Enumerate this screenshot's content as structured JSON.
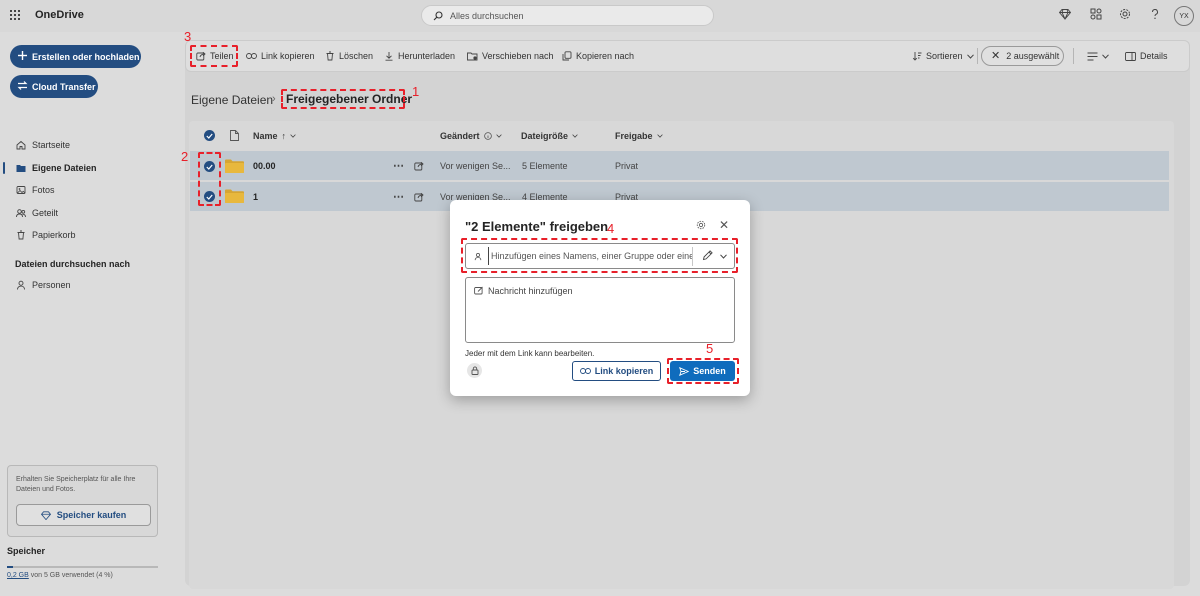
{
  "app": {
    "title": "OneDrive",
    "avatar_initials": "YX"
  },
  "search": {
    "placeholder": "Alles durchsuchen"
  },
  "sidebar": {
    "create_label": "Erstellen oder hochladen",
    "transfer_label": "Cloud Transfer",
    "items": [
      {
        "label": "Startseite",
        "icon": "home-icon"
      },
      {
        "label": "Eigene Dateien",
        "icon": "folder-icon",
        "active": true
      },
      {
        "label": "Fotos",
        "icon": "photo-icon"
      },
      {
        "label": "Geteilt",
        "icon": "people-icon"
      },
      {
        "label": "Papierkorb",
        "icon": "trash-icon"
      }
    ],
    "browse_heading": "Dateien durchsuchen nach",
    "browse_items": [
      {
        "label": "Personen",
        "icon": "person-icon"
      }
    ],
    "storage_promo": "Erhalten Sie Speicherplatz für alle Ihre Dateien und Fotos.",
    "buy_storage_label": "Speicher kaufen",
    "storage_heading": "Speicher",
    "storage_used_amount": "0,2 GB",
    "storage_used_rest": " von 5 GB verwendet (4 %)",
    "storage_fraction": 0.04
  },
  "toolbar": {
    "share": "Teilen",
    "copy_link": "Link kopieren",
    "delete": "Löschen",
    "download": "Herunterladen",
    "move_to": "Verschieben nach",
    "copy_to": "Kopieren nach",
    "sort": "Sortieren",
    "selected": "2 ausgewählt",
    "details": "Details"
  },
  "breadcrumb": {
    "root": "Eigene Dateien",
    "current": "Freigegebener Ordner"
  },
  "table": {
    "columns": {
      "name": "Name",
      "sort_indicator": "↑",
      "modified": "Geändert",
      "size": "Dateigröße",
      "sharing": "Freigabe"
    },
    "rows": [
      {
        "name": "00.00",
        "modified": "Vor wenigen Se...",
        "size": "5 Elemente",
        "sharing": "Privat"
      },
      {
        "name": "1",
        "modified": "Vor wenigen Se...",
        "size": "4 Elemente",
        "sharing": "Privat"
      }
    ]
  },
  "dialog": {
    "title": "\"2 Elemente\" freigeben",
    "people_placeholder": "Hinzufügen eines Namens, einer Gruppe oder einer",
    "message_placeholder": "Nachricht hinzufügen",
    "link_note": "Jeder mit dem Link kann bearbeiten.",
    "copy_link": "Link kopieren",
    "send": "Senden"
  },
  "annotations": [
    "1",
    "2",
    "3",
    "4",
    "5"
  ],
  "colors": {
    "accent": "#234d81",
    "send": "#0f6cbd",
    "annotation": "#e8202a"
  }
}
